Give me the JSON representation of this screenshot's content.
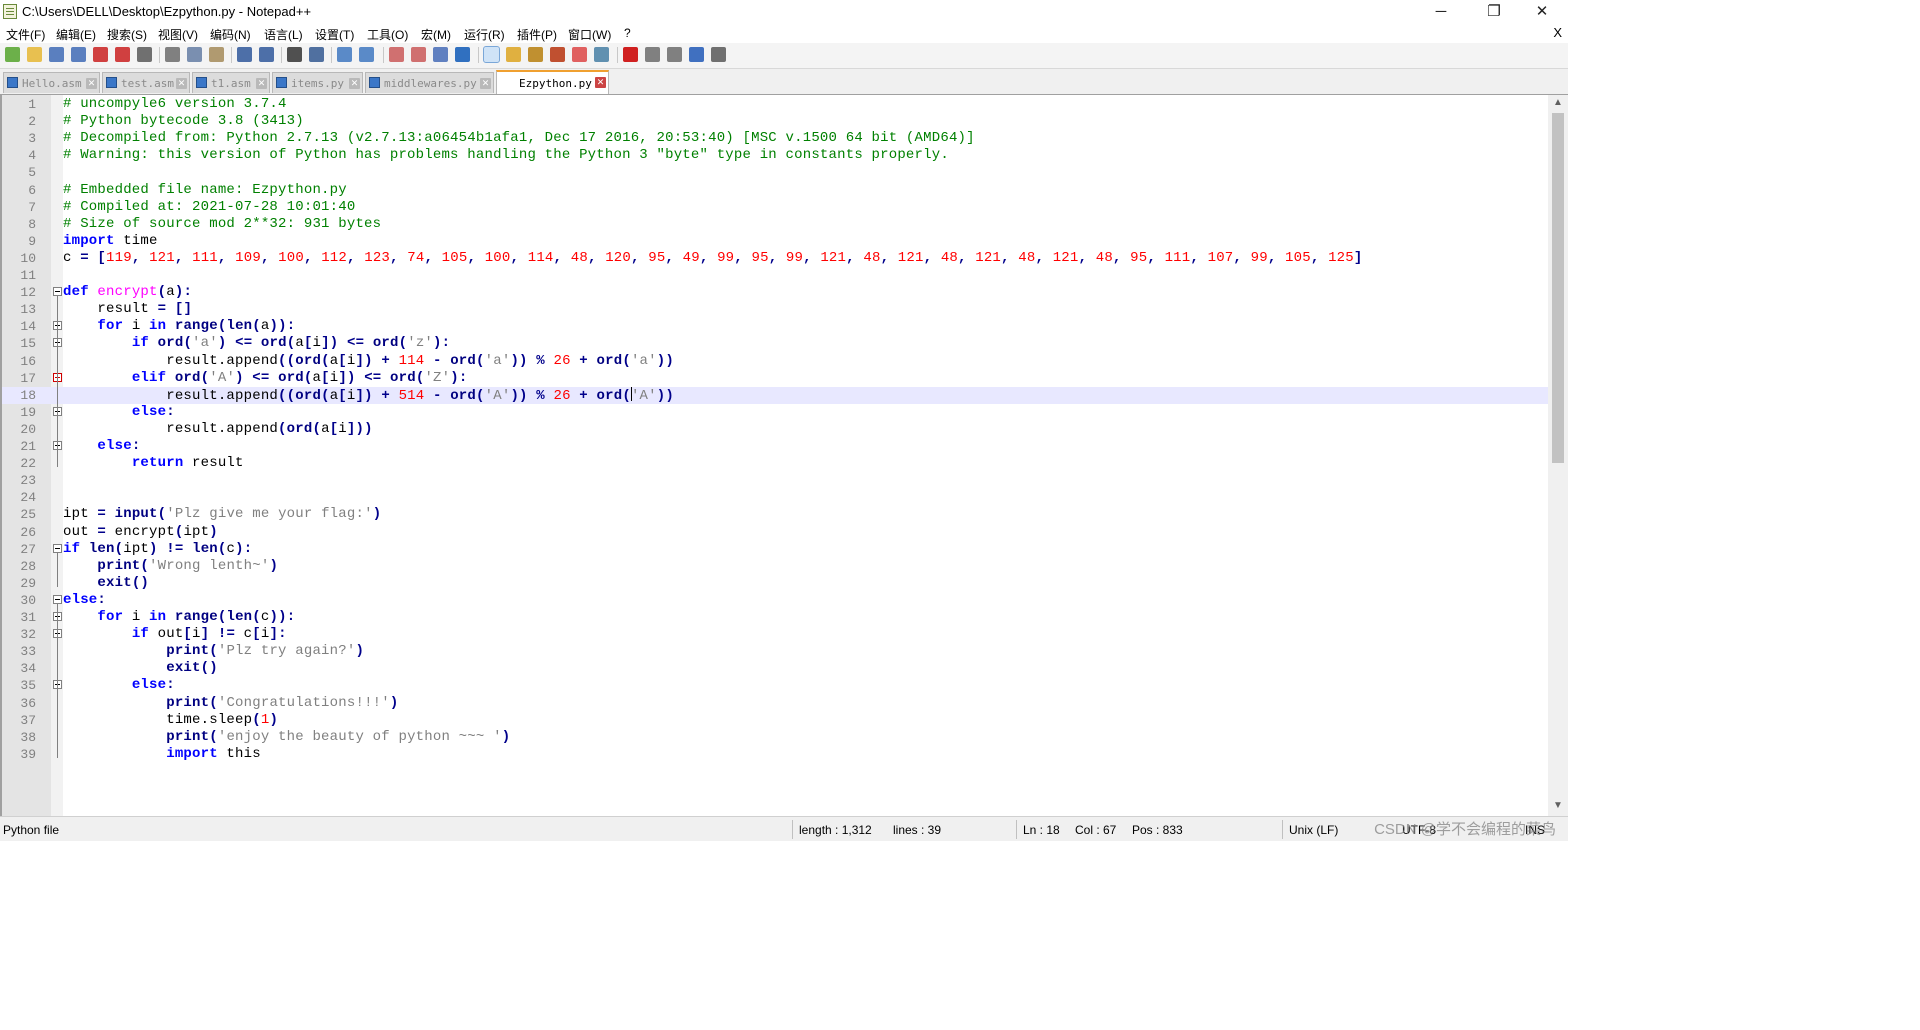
{
  "window": {
    "title": "C:\\Users\\DELL\\Desktop\\Ezpython.py - Notepad++",
    "minimize_glyph": "─",
    "restore_glyph": "❐",
    "close_glyph": "✕"
  },
  "menu": {
    "items": [
      "文件(F)",
      "编辑(E)",
      "搜索(S)",
      "视图(V)",
      "编码(N)",
      "语言(L)",
      "设置(T)",
      "工具(O)",
      "宏(M)",
      "运行(R)",
      "插件(P)",
      "窗口(W)",
      "?"
    ],
    "close_glyph": "X"
  },
  "toolbar": {
    "icons": [
      "new-file-icon",
      "open-file-icon",
      "save-icon",
      "save-all-icon",
      "close-icon",
      "close-all-icon",
      "print-icon",
      "cut-icon",
      "copy-icon",
      "paste-icon",
      "undo-icon",
      "redo-icon",
      "find-icon",
      "replace-icon",
      "zoom-in-icon",
      "zoom-out-icon",
      "sync-vertical-icon",
      "sync-horizontal-icon",
      "word-wrap-icon",
      "show-all-chars-icon",
      "indent-guide-icon",
      "user-language-icon",
      "document-map-icon",
      "function-list-icon",
      "folder-workspace-icon",
      "monitoring-icon",
      "record-macro-icon",
      "stop-record-icon",
      "play-macro-icon",
      "run-macro-multiple-icon",
      "save-macro-icon"
    ]
  },
  "tabs": [
    {
      "label": "Hello.asm",
      "active": false
    },
    {
      "label": "test.asm",
      "active": false
    },
    {
      "label": "t1.asm",
      "active": false
    },
    {
      "label": "items.py",
      "active": false
    },
    {
      "label": "middlewares.py",
      "active": false
    },
    {
      "label": "Ezpython.py",
      "active": true
    }
  ],
  "editor": {
    "current_line": 18,
    "lines": [
      "# uncompyle6 version 3.7.4",
      "# Python bytecode 3.8 (3413)",
      "# Decompiled from: Python 2.7.13 (v2.7.13:a06454b1afa1, Dec 17 2016, 20:53:40) [MSC v.1500 64 bit (AMD64)]",
      "# Warning: this version of Python has problems handling the Python 3 \"byte\" type in constants properly.",
      "",
      "# Embedded file name: Ezpython.py",
      "# Compiled at: 2021-07-28 10:01:40",
      "# Size of source mod 2**32: 931 bytes",
      "import time",
      "c = [119, 121, 111, 109, 100, 112, 123, 74, 105, 100, 114, 48, 120, 95, 49, 99, 95, 99, 121, 48, 121, 48, 121, 48, 121, 48, 95, 111, 107, 99, 105, 125]",
      "",
      "def encrypt(a):",
      "    result = []",
      "    for i in range(len(a)):",
      "        if ord('a') <= ord(a[i]) <= ord('z'):",
      "            result.append((ord(a[i]) + 114 - ord('a')) % 26 + ord('a'))",
      "        elif ord('A') <= ord(a[i]) <= ord('Z'):",
      "            result.append((ord(a[i]) + 514 - ord('A')) % 26 + ord('A'))",
      "        else:",
      "            result.append(ord(a[i]))",
      "    else:",
      "        return result",
      "",
      "",
      "ipt = input('Plz give me your flag:')",
      "out = encrypt(ipt)",
      "if len(ipt) != len(c):",
      "    print('Wrong lenth~')",
      "    exit()",
      "else:",
      "    for i in range(len(c)):",
      "        if out[i] != c[i]:",
      "            print('Plz try again?')",
      "            exit()",
      "        else:",
      "            print('Congratulations!!!')",
      "            time.sleep(1)",
      "            print('enjoy the beauty of python ~~~ ')",
      "            import this"
    ]
  },
  "scrollbar": {
    "up_glyph": "▲",
    "down_glyph": "▼"
  },
  "status": {
    "file_type": "Python file",
    "length": "length : 1,312",
    "lines": "lines : 39",
    "ln": "Ln : 18",
    "col": "Col : 67",
    "pos": "Pos : 833",
    "eol": "Unix (LF)",
    "encoding": "UTF-8",
    "mode": "INS",
    "watermark": "CSDN @学不会编程的菜鸟"
  },
  "colors": {
    "comment": "#008000",
    "keyword": "#0000ff",
    "number": "#ff0000",
    "string": "#808080",
    "function_def": "#ff00ff",
    "builtin": "#000080",
    "current_line": "#e8e8ff",
    "active_tab_accent": "#f0a030"
  }
}
